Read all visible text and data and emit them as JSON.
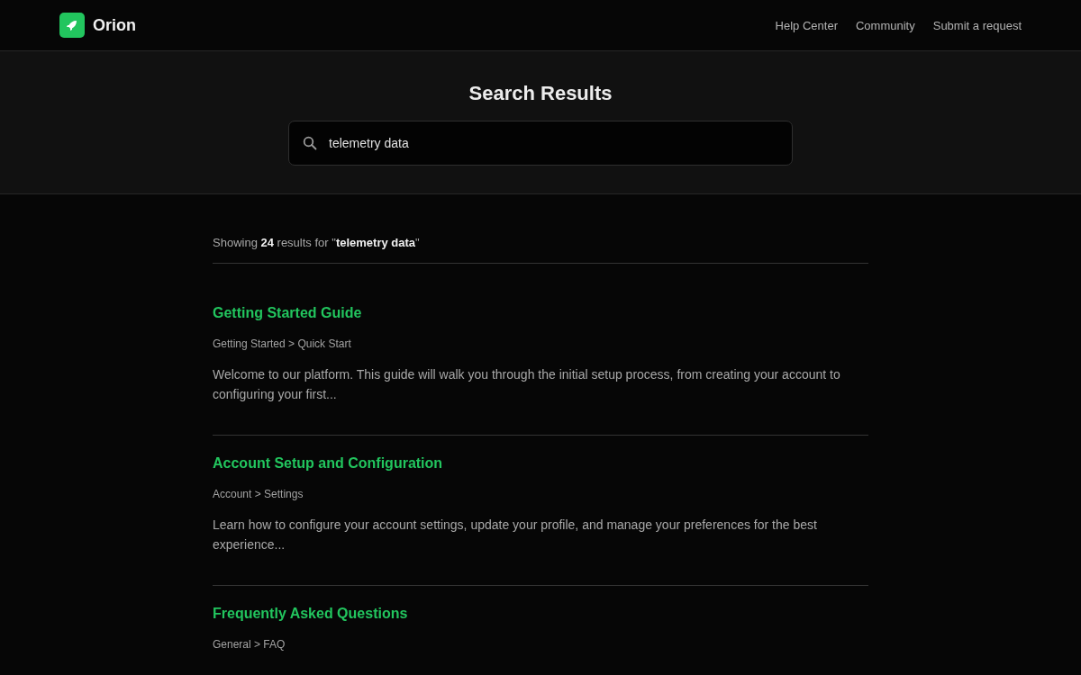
{
  "header": {
    "brand": "Orion",
    "nav": [
      {
        "label": "Help Center"
      },
      {
        "label": "Community"
      },
      {
        "label": "Submit a request"
      }
    ]
  },
  "hero": {
    "title": "Search Results",
    "search": {
      "value": "telemetry data"
    }
  },
  "summary": "Showing **24** results for \"**telemetry data**\"",
  "results": [
    {
      "title": "Getting Started Guide",
      "path": "Getting Started > Quick Start",
      "excerpt": "Welcome to our platform. This guide will walk you through the initial setup process, from creating your account to configuring your first..."
    },
    {
      "title": "Account Setup and Configuration",
      "path": "Account > Settings",
      "excerpt": "Learn how to configure your account settings, update your profile, and manage your preferences for the best experience..."
    },
    {
      "title": "Frequently Asked Questions",
      "path": "General > FAQ"
    }
  ]
}
